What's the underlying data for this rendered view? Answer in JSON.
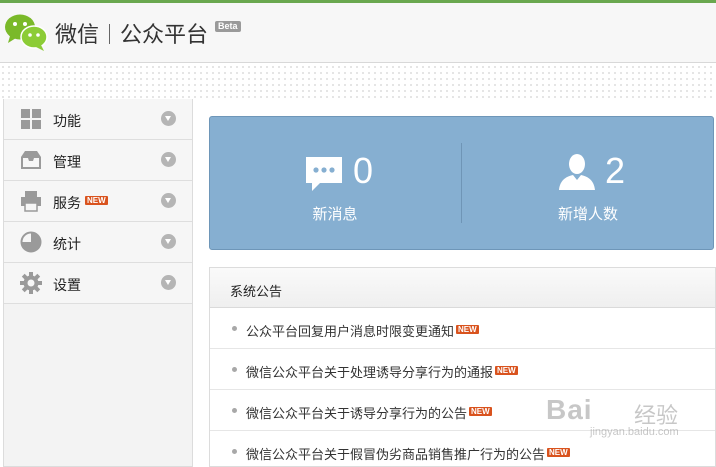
{
  "header": {
    "brand_name": "微信",
    "brand_product": "公众平台",
    "beta_label": "Beta"
  },
  "sidebar": {
    "items": [
      {
        "label": "功能",
        "icon": "grid-icon"
      },
      {
        "label": "管理",
        "icon": "inbox-icon"
      },
      {
        "label": "服务",
        "icon": "printer-icon",
        "badge": "NEW"
      },
      {
        "label": "统计",
        "icon": "pie-chart-icon"
      },
      {
        "label": "设置",
        "icon": "gear-icon"
      }
    ]
  },
  "stats": {
    "messages": {
      "value": "0",
      "label": "新消息",
      "icon": "chat-bubble-icon"
    },
    "new_users": {
      "value": "2",
      "label": "新增人数",
      "icon": "user-icon"
    }
  },
  "notice": {
    "title": "系统公告",
    "items": [
      {
        "text": "公众平台回复用户消息时限变更通知",
        "badge": "NEW"
      },
      {
        "text": "微信公众平台关于处理诱导分享行为的通报",
        "badge": "NEW"
      },
      {
        "text": "微信公众平台关于诱导分享行为的公告",
        "badge": "NEW"
      },
      {
        "text": "微信公众平台关于假冒伪劣商品销售推广行为的公告",
        "badge": "NEW"
      }
    ]
  },
  "watermark": {
    "brand": "Bai",
    "cn": "经验",
    "url": "jingyan.baidu.com"
  },
  "colors": {
    "accent_green": "#6aa84f",
    "stats_blue": "#86afd1",
    "new_badge": "#d9531e"
  }
}
